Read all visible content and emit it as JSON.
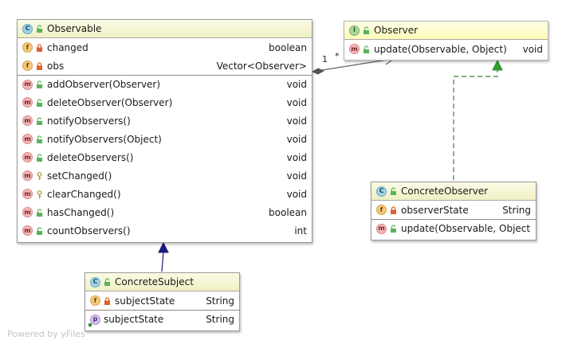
{
  "classes": {
    "observable": {
      "kind_icon": "C",
      "name": "Observable",
      "fields": [
        {
          "icon": "f",
          "visibility": "private",
          "name": "changed",
          "type": "boolean"
        },
        {
          "icon": "f",
          "visibility": "private",
          "name": "obs",
          "type": "Vector<Observer>"
        }
      ],
      "methods": [
        {
          "icon": "m",
          "visibility": "public",
          "name": "addObserver(Observer)",
          "type": "void"
        },
        {
          "icon": "m",
          "visibility": "public",
          "name": "deleteObserver(Observer)",
          "type": "void"
        },
        {
          "icon": "m",
          "visibility": "public",
          "name": "notifyObservers()",
          "type": "void"
        },
        {
          "icon": "m",
          "visibility": "public",
          "name": "notifyObservers(Object)",
          "type": "void"
        },
        {
          "icon": "m",
          "visibility": "public",
          "name": "deleteObservers()",
          "type": "void"
        },
        {
          "icon": "m",
          "visibility": "protected",
          "name": "setChanged()",
          "type": "void"
        },
        {
          "icon": "m",
          "visibility": "protected",
          "name": "clearChanged()",
          "type": "void"
        },
        {
          "icon": "m",
          "visibility": "public",
          "name": "hasChanged()",
          "type": "boolean"
        },
        {
          "icon": "m",
          "visibility": "public",
          "name": "countObservers()",
          "type": "int"
        }
      ]
    },
    "observer": {
      "kind_icon": "I",
      "name": "Observer",
      "methods": [
        {
          "icon": "m",
          "visibility": "public",
          "name": "update(Observable, Object)",
          "type": "void"
        }
      ]
    },
    "concrete_observer": {
      "kind_icon": "C",
      "name": "ConcreteObserver",
      "fields": [
        {
          "icon": "f",
          "visibility": "private",
          "name": "observerState",
          "type": "String"
        }
      ],
      "methods": [
        {
          "icon": "m",
          "visibility": "public",
          "name": "update(Observable, Object)",
          "type": ""
        }
      ]
    },
    "concrete_subject": {
      "kind_icon": "C",
      "name": "ConcreteSubject",
      "fields": [
        {
          "icon": "f",
          "visibility": "private",
          "name": "subjectState",
          "type": "String"
        }
      ],
      "properties": [
        {
          "icon": "p",
          "name": "subjectState",
          "type": "String"
        }
      ]
    }
  },
  "association": {
    "source_multiplicity": "1",
    "target_multiplicity": "*"
  },
  "colors": {
    "association_line": "#666666",
    "inheritance_line": "#1a1a6e",
    "realization_line": "#2e8b2e"
  },
  "watermark": "Powered by yFiles"
}
